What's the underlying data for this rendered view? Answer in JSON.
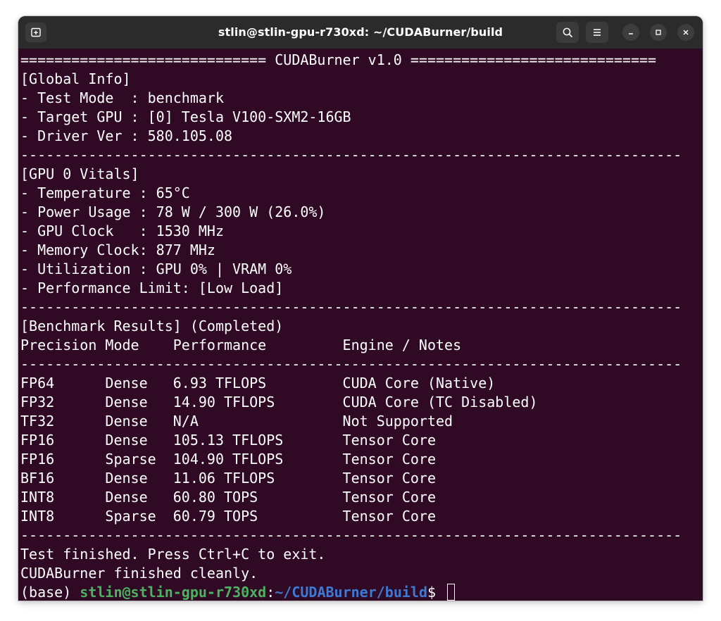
{
  "window": {
    "title": "stlin@stlin-gpu-r730xd: ~/CUDABurner/build"
  },
  "terminal": {
    "lines": [
      "============================= CUDABurner v1.0 =============================",
      "[Global Info]",
      "- Test Mode  : benchmark",
      "- Target GPU : [0] Tesla V100-SXM2-16GB",
      "- Driver Ver : 580.105.08",
      "------------------------------------------------------------------------------",
      "[GPU 0 Vitals]",
      "- Temperature : 65°C",
      "- Power Usage : 78 W / 300 W (26.0%)",
      "- GPU Clock   : 1530 MHz",
      "- Memory Clock: 877 MHz",
      "- Utilization : GPU 0% | VRAM 0%",
      "- Performance Limit: [Low Load]",
      "------------------------------------------------------------------------------",
      "[Benchmark Results] (Completed)",
      "Precision Mode    Performance         Engine / Notes",
      "------------------------------------------------------------------------------",
      "FP64      Dense   6.93 TFLOPS         CUDA Core (Native)",
      "FP32      Dense   14.90 TFLOPS        CUDA Core (TC Disabled)",
      "TF32      Dense   N/A                 Not Supported",
      "FP16      Dense   105.13 TFLOPS       Tensor Core",
      "FP16      Sparse  104.90 TFLOPS       Tensor Core",
      "BF16      Dense   11.06 TFLOPS        Tensor Core",
      "INT8      Dense   60.80 TOPS          Tensor Core",
      "INT8      Sparse  60.79 TOPS          Tensor Core",
      "------------------------------------------------------------------------------",
      "Test finished. Press Ctrl+C to exit.",
      "CUDABurner finished cleanly."
    ],
    "prompt": {
      "env": "(base) ",
      "user_host": "stlin@stlin-gpu-r730xd",
      "separator": ":",
      "path": "~/CUDABurner/build",
      "symbol": "$ "
    }
  },
  "icons": {
    "new_tab": "new-tab-icon",
    "search": "search-icon",
    "menu": "hamburger-menu-icon",
    "minimize": "minimize-icon",
    "maximize": "maximize-icon",
    "close": "close-icon"
  },
  "colors": {
    "terminal_bg": "#300a24",
    "titlebar_bg": "#2b2b2b",
    "prompt_user": "#4bb35f",
    "prompt_path": "#3f79d4"
  }
}
